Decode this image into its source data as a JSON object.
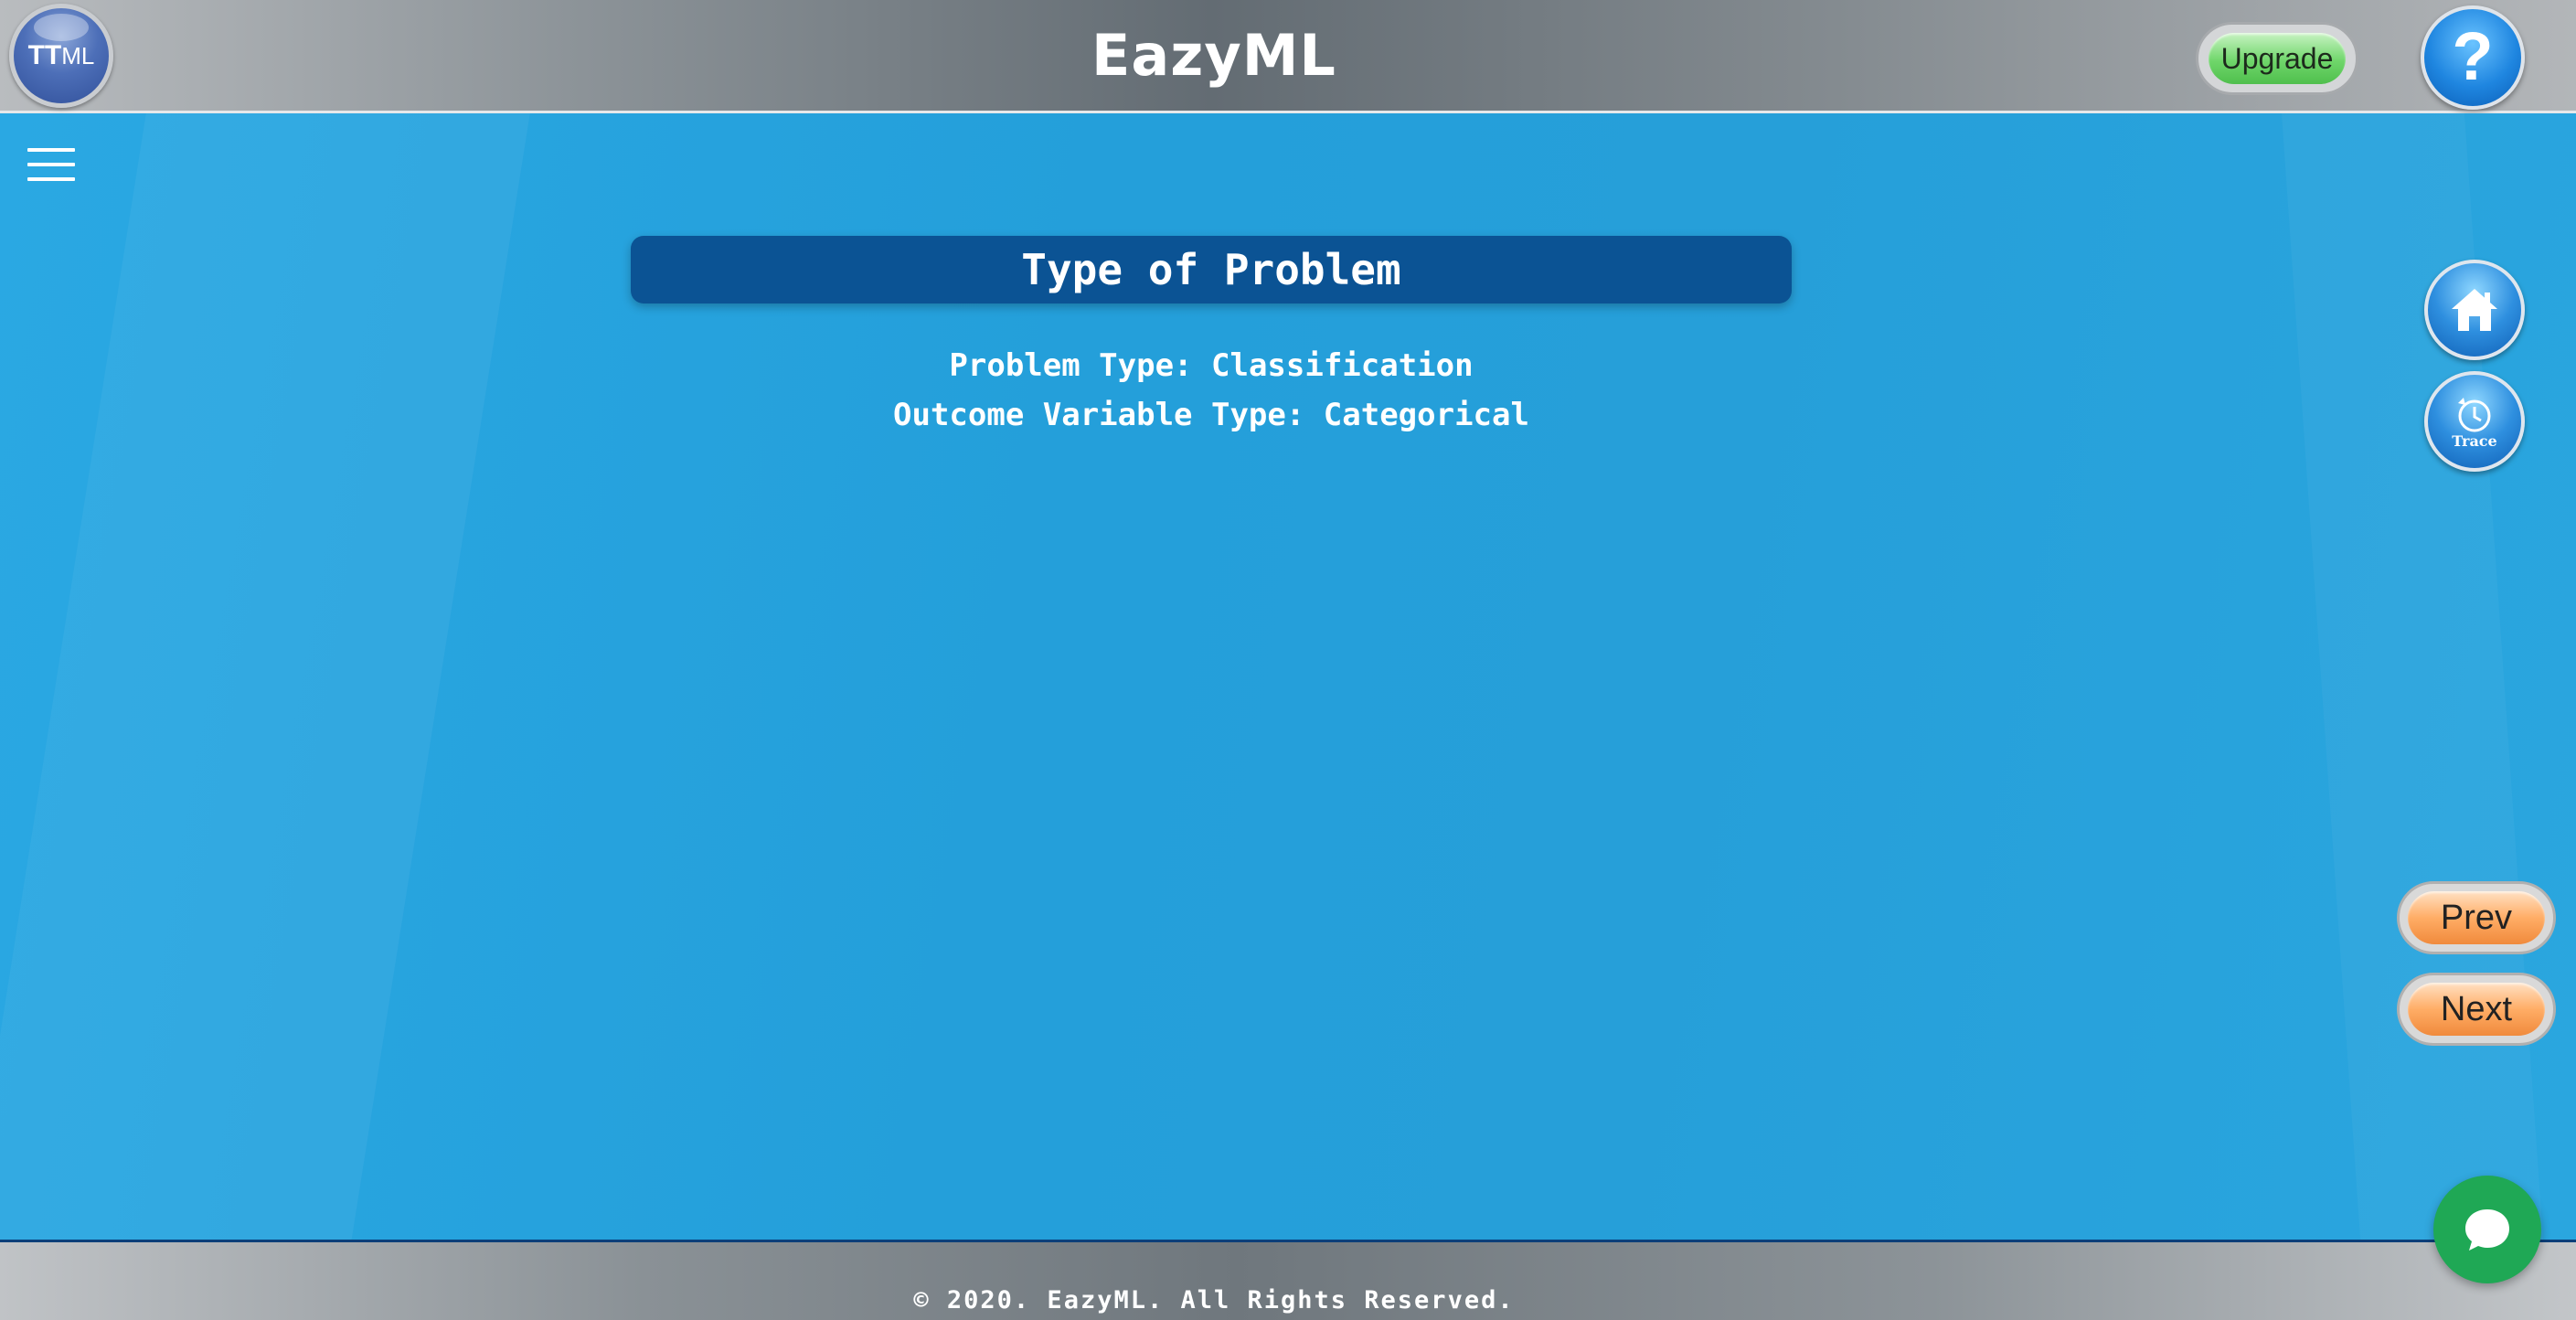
{
  "header": {
    "logo_text": "TT",
    "logo_suffix": "ML",
    "app_title": "EazyML",
    "upgrade_label": "Upgrade",
    "help_symbol": "?"
  },
  "sidebar": {
    "menu_icon": "hamburger-menu-icon"
  },
  "main": {
    "section_title": "Type of Problem",
    "problem_type_line": "Problem Type: Classification",
    "outcome_type_line": "Outcome Variable Type: Categorical"
  },
  "side_nav": {
    "home_icon": "home-icon",
    "trace_label": "Trace",
    "prev_label": "Prev",
    "next_label": "Next"
  },
  "footer": {
    "copyright": "© 2020. EazyML. All Rights Reserved."
  },
  "chat": {
    "icon": "chat-bubble-icon"
  },
  "colors": {
    "main_bg": "#27a3dd",
    "title_bar": "#0b5394",
    "upgrade_green": "#6fd66a",
    "nav_orange": "#ffad66",
    "chat_green": "#1fa855"
  }
}
